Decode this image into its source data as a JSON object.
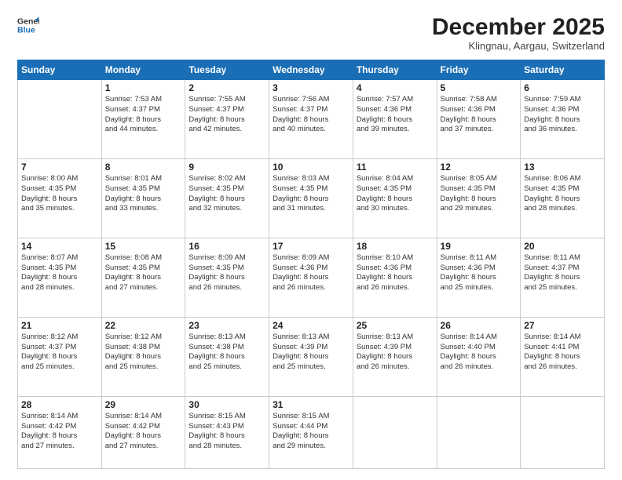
{
  "header": {
    "logo_line1": "General",
    "logo_line2": "Blue",
    "month_title": "December 2025",
    "location": "Klingnau, Aargau, Switzerland"
  },
  "days_of_week": [
    "Sunday",
    "Monday",
    "Tuesday",
    "Wednesday",
    "Thursday",
    "Friday",
    "Saturday"
  ],
  "weeks": [
    [
      {
        "day": "",
        "info": ""
      },
      {
        "day": "1",
        "info": "Sunrise: 7:53 AM\nSunset: 4:37 PM\nDaylight: 8 hours\nand 44 minutes."
      },
      {
        "day": "2",
        "info": "Sunrise: 7:55 AM\nSunset: 4:37 PM\nDaylight: 8 hours\nand 42 minutes."
      },
      {
        "day": "3",
        "info": "Sunrise: 7:56 AM\nSunset: 4:37 PM\nDaylight: 8 hours\nand 40 minutes."
      },
      {
        "day": "4",
        "info": "Sunrise: 7:57 AM\nSunset: 4:36 PM\nDaylight: 8 hours\nand 39 minutes."
      },
      {
        "day": "5",
        "info": "Sunrise: 7:58 AM\nSunset: 4:36 PM\nDaylight: 8 hours\nand 37 minutes."
      },
      {
        "day": "6",
        "info": "Sunrise: 7:59 AM\nSunset: 4:36 PM\nDaylight: 8 hours\nand 36 minutes."
      }
    ],
    [
      {
        "day": "7",
        "info": "Sunrise: 8:00 AM\nSunset: 4:35 PM\nDaylight: 8 hours\nand 35 minutes."
      },
      {
        "day": "8",
        "info": "Sunrise: 8:01 AM\nSunset: 4:35 PM\nDaylight: 8 hours\nand 33 minutes."
      },
      {
        "day": "9",
        "info": "Sunrise: 8:02 AM\nSunset: 4:35 PM\nDaylight: 8 hours\nand 32 minutes."
      },
      {
        "day": "10",
        "info": "Sunrise: 8:03 AM\nSunset: 4:35 PM\nDaylight: 8 hours\nand 31 minutes."
      },
      {
        "day": "11",
        "info": "Sunrise: 8:04 AM\nSunset: 4:35 PM\nDaylight: 8 hours\nand 30 minutes."
      },
      {
        "day": "12",
        "info": "Sunrise: 8:05 AM\nSunset: 4:35 PM\nDaylight: 8 hours\nand 29 minutes."
      },
      {
        "day": "13",
        "info": "Sunrise: 8:06 AM\nSunset: 4:35 PM\nDaylight: 8 hours\nand 28 minutes."
      }
    ],
    [
      {
        "day": "14",
        "info": "Sunrise: 8:07 AM\nSunset: 4:35 PM\nDaylight: 8 hours\nand 28 minutes."
      },
      {
        "day": "15",
        "info": "Sunrise: 8:08 AM\nSunset: 4:35 PM\nDaylight: 8 hours\nand 27 minutes."
      },
      {
        "day": "16",
        "info": "Sunrise: 8:09 AM\nSunset: 4:35 PM\nDaylight: 8 hours\nand 26 minutes."
      },
      {
        "day": "17",
        "info": "Sunrise: 8:09 AM\nSunset: 4:36 PM\nDaylight: 8 hours\nand 26 minutes."
      },
      {
        "day": "18",
        "info": "Sunrise: 8:10 AM\nSunset: 4:36 PM\nDaylight: 8 hours\nand 26 minutes."
      },
      {
        "day": "19",
        "info": "Sunrise: 8:11 AM\nSunset: 4:36 PM\nDaylight: 8 hours\nand 25 minutes."
      },
      {
        "day": "20",
        "info": "Sunrise: 8:11 AM\nSunset: 4:37 PM\nDaylight: 8 hours\nand 25 minutes."
      }
    ],
    [
      {
        "day": "21",
        "info": "Sunrise: 8:12 AM\nSunset: 4:37 PM\nDaylight: 8 hours\nand 25 minutes."
      },
      {
        "day": "22",
        "info": "Sunrise: 8:12 AM\nSunset: 4:38 PM\nDaylight: 8 hours\nand 25 minutes."
      },
      {
        "day": "23",
        "info": "Sunrise: 8:13 AM\nSunset: 4:38 PM\nDaylight: 8 hours\nand 25 minutes."
      },
      {
        "day": "24",
        "info": "Sunrise: 8:13 AM\nSunset: 4:39 PM\nDaylight: 8 hours\nand 25 minutes."
      },
      {
        "day": "25",
        "info": "Sunrise: 8:13 AM\nSunset: 4:39 PM\nDaylight: 8 hours\nand 26 minutes."
      },
      {
        "day": "26",
        "info": "Sunrise: 8:14 AM\nSunset: 4:40 PM\nDaylight: 8 hours\nand 26 minutes."
      },
      {
        "day": "27",
        "info": "Sunrise: 8:14 AM\nSunset: 4:41 PM\nDaylight: 8 hours\nand 26 minutes."
      }
    ],
    [
      {
        "day": "28",
        "info": "Sunrise: 8:14 AM\nSunset: 4:42 PM\nDaylight: 8 hours\nand 27 minutes."
      },
      {
        "day": "29",
        "info": "Sunrise: 8:14 AM\nSunset: 4:42 PM\nDaylight: 8 hours\nand 27 minutes."
      },
      {
        "day": "30",
        "info": "Sunrise: 8:15 AM\nSunset: 4:43 PM\nDaylight: 8 hours\nand 28 minutes."
      },
      {
        "day": "31",
        "info": "Sunrise: 8:15 AM\nSunset: 4:44 PM\nDaylight: 8 hours\nand 29 minutes."
      },
      {
        "day": "",
        "info": ""
      },
      {
        "day": "",
        "info": ""
      },
      {
        "day": "",
        "info": ""
      }
    ]
  ]
}
